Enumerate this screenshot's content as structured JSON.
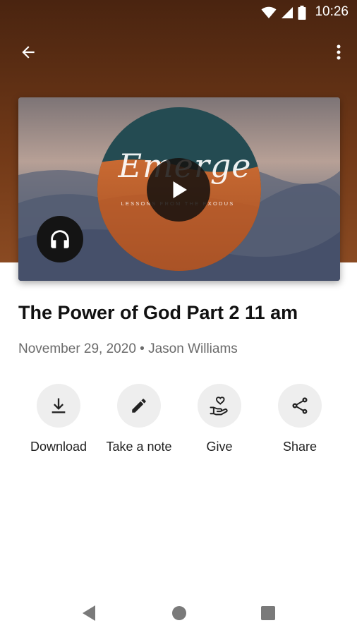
{
  "status_bar": {
    "time": "10:26",
    "icons": [
      "wifi-icon",
      "cell-signal-icon",
      "battery-icon"
    ]
  },
  "app_bar": {
    "back_icon": "arrow-back-icon",
    "more_icon": "more-vert-icon"
  },
  "artwork": {
    "title": "Emerge",
    "subtitle": "LESSONS FROM THE EXODUS",
    "play_icon": "play-icon",
    "audio_icon": "headphones-icon"
  },
  "sermon": {
    "title": "The Power of God Part 2 11 am",
    "meta": "November 29, 2020 • Jason Williams"
  },
  "actions": [
    {
      "label": "Download",
      "icon": "download-icon"
    },
    {
      "label": "Take a note",
      "icon": "pencil-icon"
    },
    {
      "label": "Give",
      "icon": "give-heart-hand-icon"
    },
    {
      "label": "Share",
      "icon": "share-icon"
    }
  ],
  "nav_bar": {
    "buttons": [
      "back-triangle-icon",
      "home-circle-icon",
      "recents-square-icon"
    ]
  },
  "colors": {
    "header_brown": "#5a2d13",
    "action_circle": "#eeeeee",
    "title_text": "#111111",
    "meta_text": "#6b6b6b"
  }
}
